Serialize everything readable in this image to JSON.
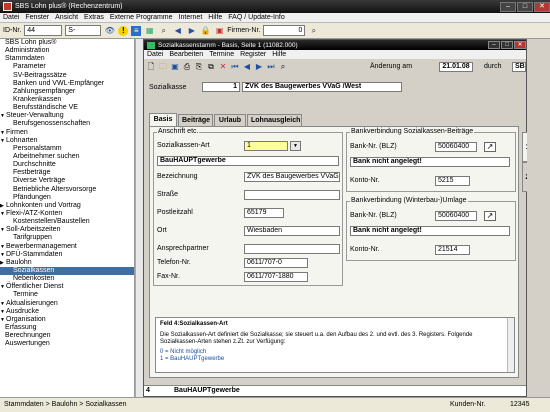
{
  "window": {
    "title": "SBS Lohn plus® (Rechenzentrum)"
  },
  "menubar": [
    "Datei",
    "Fenster",
    "Ansicht",
    "Extras",
    "Externe Programme",
    "Internet",
    "Hilfe",
    "FAQ / Update-Info"
  ],
  "toolbar": {
    "id_label": "ID-Nr.",
    "id_value": "44",
    "s_value": "S-",
    "firmen_label": "Firmen-Nr.",
    "firmen_value": "0"
  },
  "nav": [
    {
      "label": "SBS Lohn plus®",
      "indent": 0
    },
    {
      "label": "Administration",
      "indent": 0
    },
    {
      "label": "Stammdaten",
      "indent": 0
    },
    {
      "label": "Parameter",
      "indent": 1
    },
    {
      "label": "SV-Beitragssätze",
      "indent": 1
    },
    {
      "label": "Banken und VWL-Empfänger",
      "indent": 1
    },
    {
      "label": "Zahlungsempfänger",
      "indent": 1
    },
    {
      "label": "Krankenkassen",
      "indent": 1
    },
    {
      "label": "Berufsständische VE",
      "indent": 1
    },
    {
      "label": "Steuer-Verwaltung",
      "indent": 0,
      "arrow": "▼"
    },
    {
      "label": "Berufsgenossenschaften",
      "indent": 1
    },
    {
      "label": "Firmen",
      "indent": 0,
      "arrow": "▼"
    },
    {
      "label": "Lohnarten",
      "indent": 0,
      "arrow": "▼"
    },
    {
      "label": "Personalstamm",
      "indent": 1
    },
    {
      "label": "Arbeitnehmer suchen",
      "indent": 1
    },
    {
      "label": "Durchschnitte",
      "indent": 1
    },
    {
      "label": "Festbeträge",
      "indent": 1
    },
    {
      "label": "Diverse Verträge",
      "indent": 1
    },
    {
      "label": "Betriebliche Altersvorsorge",
      "indent": 1
    },
    {
      "label": "Pfändungen",
      "indent": 1
    },
    {
      "label": "Lohnkonten und Vortrag",
      "indent": 0,
      "arrow": "▶"
    },
    {
      "label": "Flexi-/ATZ-Konten",
      "indent": 0,
      "arrow": "▼"
    },
    {
      "label": "Kostenstellen/Baustellen",
      "indent": 1
    },
    {
      "label": "Soll-Arbeitszeiten",
      "indent": 0,
      "arrow": "▼"
    },
    {
      "label": "Tarifgruppen",
      "indent": 1
    },
    {
      "label": "Bewerbermanagement",
      "indent": 0,
      "arrow": "▼"
    },
    {
      "label": "DFÜ-Stammdaten",
      "indent": 0,
      "arrow": "▼"
    },
    {
      "label": "Baulohn",
      "indent": 0,
      "arrow": "▶"
    },
    {
      "label": "Sozialkassen",
      "indent": 1,
      "selected": true
    },
    {
      "label": "Nebenkosten",
      "indent": 1
    },
    {
      "label": "Öffentlicher Dienst",
      "indent": 0,
      "arrow": "▼"
    },
    {
      "label": "Termine",
      "indent": 1
    },
    {
      "label": "Aktualisierungen",
      "indent": 0,
      "arrow": "▼"
    },
    {
      "label": "Ausdrucke",
      "indent": 0,
      "arrow": "▼"
    },
    {
      "label": "Organisation",
      "indent": 0,
      "arrow": "▼"
    },
    {
      "label": "Erfassung",
      "indent": 0
    },
    {
      "label": "Berechnungen",
      "indent": 0
    },
    {
      "label": "Auswertungen",
      "indent": 0
    }
  ],
  "child": {
    "title": "Sozialkassenstamm - Basis, Seite 1 (11082.000)",
    "menu": [
      "Datei",
      "Bearbeiten",
      "Termine",
      "Register",
      "Hilfe"
    ],
    "aenderung_label": "Änderung am",
    "aenderung_date": "21.01.08",
    "durch_label": "durch",
    "durch_value": "SBS",
    "sozialkasse_label": "Sozialkasse",
    "sozialkasse_nr": "1",
    "sozialkasse_name": "ZVK des Baugewerbes VVaG /West",
    "tabs": [
      "Basis",
      "Beiträge",
      "Urlaub",
      "Lohnausgleich"
    ],
    "page_tabs": [
      "1",
      "2"
    ],
    "anschrift": {
      "legend": "Anschrift etc.",
      "art_label": "Sozialkassen-Art",
      "art_value": "1",
      "name": "BauHAUPTgewerbe",
      "bez_label": "Bezeichnung",
      "bez_value": "ZVK des Baugewerbes VVaG",
      "strasse_label": "Straße",
      "strasse_value": "",
      "plz_label": "Postleitzahl",
      "plz_value": "65179",
      "ort_label": "Ort",
      "ort_value": "Wiesbaden",
      "ansp_label": "Ansprechpartner",
      "ansp_value": "",
      "tel_label": "Telefon-Nr.",
      "tel_value": "0611/707-0",
      "fax_label": "Fax-Nr.",
      "fax_value": "0611/707-1880"
    },
    "bank1": {
      "legend": "Bankverbindung Sozialkassen-Beiträge",
      "blz_label": "Bank-Nr. (BLZ)",
      "blz_value": "50060400",
      "bank_name": "Bank nicht angelegt!",
      "konto_label": "Konto-Nr.",
      "konto_value": "5215"
    },
    "bank2": {
      "legend": "Bankverbindung (Winterbau-)Umlage",
      "blz_label": "Bank-Nr. (BLZ)",
      "blz_value": "50060400",
      "bank_name": "Bank nicht angelegt!",
      "konto_label": "Konto-Nr.",
      "konto_value": "21514"
    },
    "help": {
      "title": "Feld 4:Sozialkassen-Art",
      "text": "Die Sozialkassen-Art definiert die Sozialkasse; sie steuert u.a. den Aufbau des 2. und evtl. des 3. Registers. Folgende Sozialkassen-Arten stehen z.Zt. zur Verfügung:",
      "opt0": "0 = Nicht möglich",
      "opt1": "1 = BauHAUPTgewerbe"
    },
    "status_nr": "4",
    "status_text": "BauHAUPTgewerbe"
  },
  "statusbar": {
    "breadcrumb": "Stammdaten > Baulohn > Sozialkassen",
    "kunden_label": "Kunden-Nr.",
    "kunden_value": "12345"
  }
}
